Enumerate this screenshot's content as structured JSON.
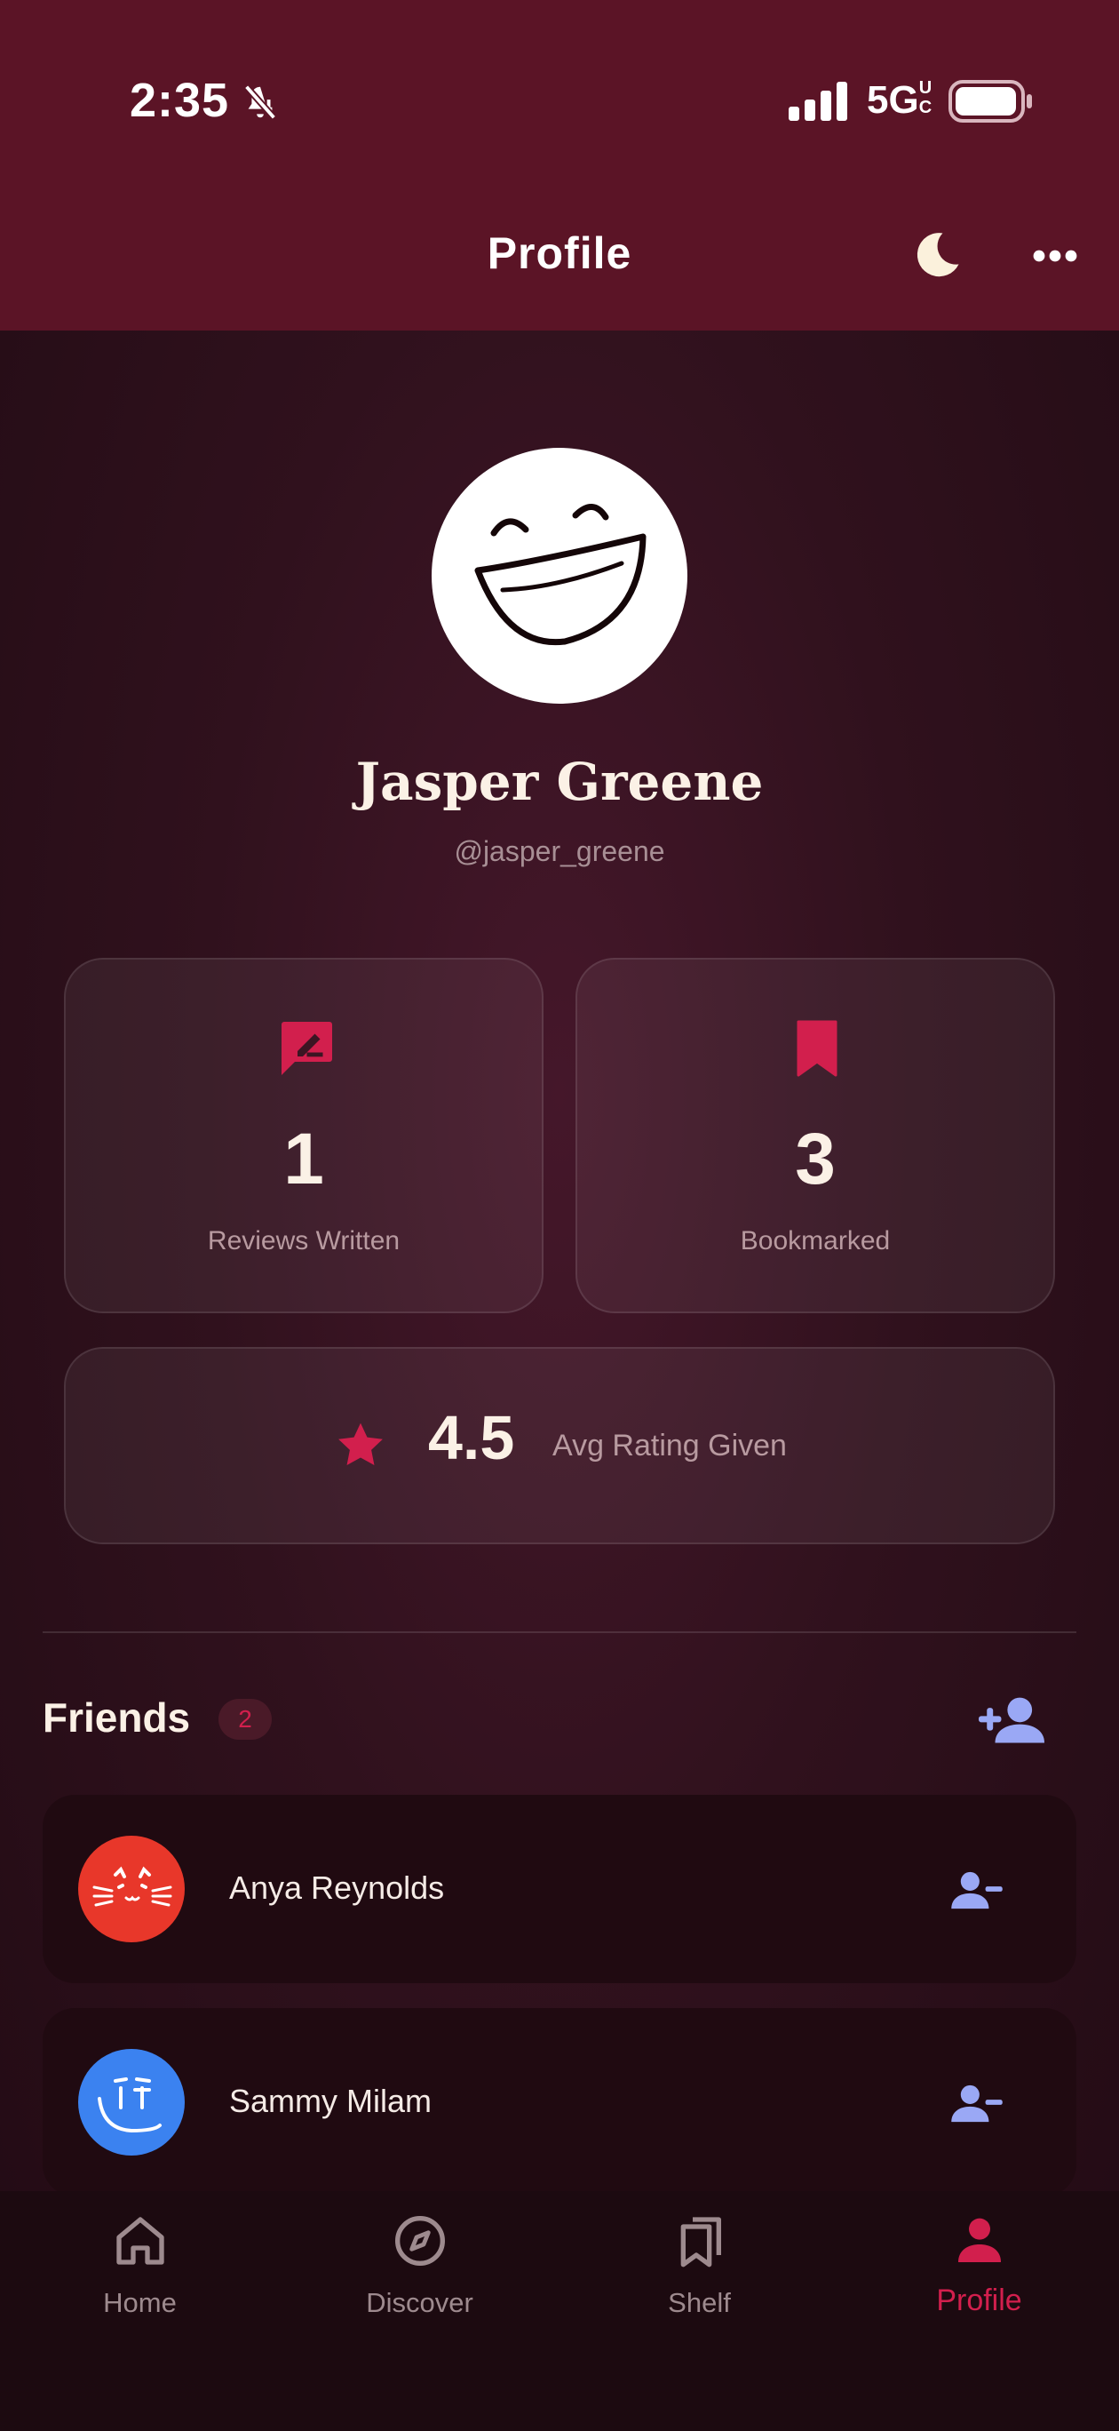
{
  "status_bar": {
    "time": "2:35",
    "network": "5G",
    "network_suffix": "UC"
  },
  "header": {
    "title": "Profile",
    "icons": [
      "moon-icon",
      "more-icon"
    ]
  },
  "profile": {
    "name": "Jasper Greene",
    "handle": "@jasper_greene"
  },
  "stats": {
    "reviews": {
      "value": "1",
      "label": "Reviews Written",
      "icon": "review-icon"
    },
    "bookmarks": {
      "value": "3",
      "label": "Bookmarked",
      "icon": "bookmark-icon"
    },
    "rating": {
      "value": "4.5",
      "label": "Avg Rating Given",
      "icon": "star-icon"
    }
  },
  "friends": {
    "title": "Friends",
    "count": "2",
    "items": [
      {
        "name": "Anya Reynolds",
        "avatar_color": "#e8372a"
      },
      {
        "name": "Sammy Milam",
        "avatar_color": "#3b82f0"
      }
    ]
  },
  "nav": {
    "items": [
      {
        "label": "Home",
        "icon": "home-icon"
      },
      {
        "label": "Discover",
        "icon": "compass-icon"
      },
      {
        "label": "Shelf",
        "icon": "shelf-icon"
      },
      {
        "label": "Profile",
        "icon": "person-icon",
        "active": true
      }
    ]
  },
  "colors": {
    "header_bg": "#5b1426",
    "accent": "#d21f4d",
    "friend_action": "#9aa8f5"
  }
}
